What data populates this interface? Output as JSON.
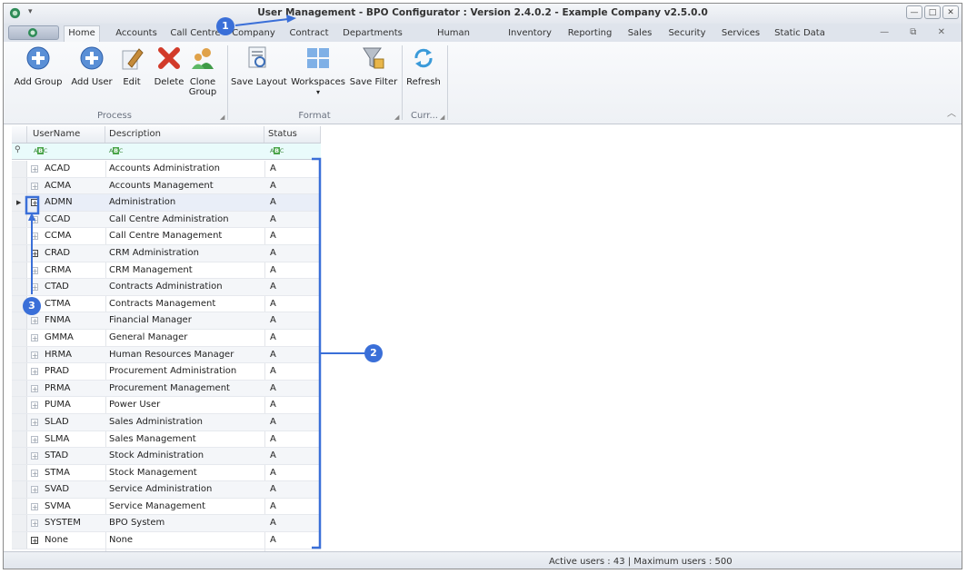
{
  "window": {
    "title": "User Management - BPO Configurator : Version 2.4.0.2 - Example Company v2.5.0.0",
    "controls": {
      "minimize": "—",
      "maximize": "□",
      "close": "✕"
    },
    "mdi_controls": "— ⧉ ✕"
  },
  "tabs": [
    {
      "label": "Home",
      "active": true
    },
    {
      "label": "Accounts"
    },
    {
      "label": "Call Centre"
    },
    {
      "label": "Company"
    },
    {
      "label": "Contract"
    },
    {
      "label": "Departments"
    },
    {
      "label": "Human Resources"
    },
    {
      "label": "Inventory"
    },
    {
      "label": "Reporting"
    },
    {
      "label": "Sales"
    },
    {
      "label": "Security"
    },
    {
      "label": "Services"
    },
    {
      "label": "Static Data"
    }
  ],
  "ribbon": {
    "process": {
      "label": "Process",
      "add_group": "Add Group",
      "add_user": "Add User",
      "edit": "Edit",
      "delete": "Delete",
      "clone_group_1": "Clone",
      "clone_group_2": "Group"
    },
    "format": {
      "label": "Format",
      "save_layout": "Save Layout",
      "workspaces": "Workspaces",
      "save_filter": "Save Filter"
    },
    "current": {
      "label": "Curr...",
      "refresh": "Refresh"
    }
  },
  "grid": {
    "columns": [
      "UserName",
      "Description",
      "Status"
    ],
    "rows": [
      {
        "username": "ACAD",
        "description": "Accounts Administration",
        "status": "A"
      },
      {
        "username": "ACMA",
        "description": "Accounts Management",
        "status": "A"
      },
      {
        "username": "ADMN",
        "description": "Administration",
        "status": "A"
      },
      {
        "username": "CCAD",
        "description": "Call Centre Administration",
        "status": "A"
      },
      {
        "username": "CCMA",
        "description": "Call Centre Management",
        "status": "A"
      },
      {
        "username": "CRAD",
        "description": "CRM Administration",
        "status": "A"
      },
      {
        "username": "CRMA",
        "description": "CRM Management",
        "status": "A"
      },
      {
        "username": "CTAD",
        "description": "Contracts Administration",
        "status": "A"
      },
      {
        "username": "CTMA",
        "description": "Contracts Management",
        "status": "A"
      },
      {
        "username": "FNMA",
        "description": "Financial Manager",
        "status": "A"
      },
      {
        "username": "GMMA",
        "description": "General Manager",
        "status": "A"
      },
      {
        "username": "HRMA",
        "description": "Human Resources Manager",
        "status": "A"
      },
      {
        "username": "PRAD",
        "description": "Procurement Administration",
        "status": "A"
      },
      {
        "username": "PRMA",
        "description": "Procurement Management",
        "status": "A"
      },
      {
        "username": "PUMA",
        "description": "Power User",
        "status": "A"
      },
      {
        "username": "SLAD",
        "description": "Sales Administration",
        "status": "A"
      },
      {
        "username": "SLMA",
        "description": "Sales Management",
        "status": "A"
      },
      {
        "username": "STAD",
        "description": "Stock Administration",
        "status": "A"
      },
      {
        "username": "STMA",
        "description": "Stock Management",
        "status": "A"
      },
      {
        "username": "SVAD",
        "description": "Service Administration",
        "status": "A"
      },
      {
        "username": "SVMA",
        "description": "Service Management",
        "status": "A"
      },
      {
        "username": "SYSTEM",
        "description": "BPO System",
        "status": "A"
      },
      {
        "username": "None",
        "description": "None",
        "status": "A"
      }
    ]
  },
  "status_bar": {
    "text": "Active users : 43  |  Maximum users : 500"
  },
  "callouts": [
    "1",
    "2",
    "3"
  ],
  "colors": {
    "accent": "#3a6fd8",
    "filter_row": "#e9fbfb"
  }
}
